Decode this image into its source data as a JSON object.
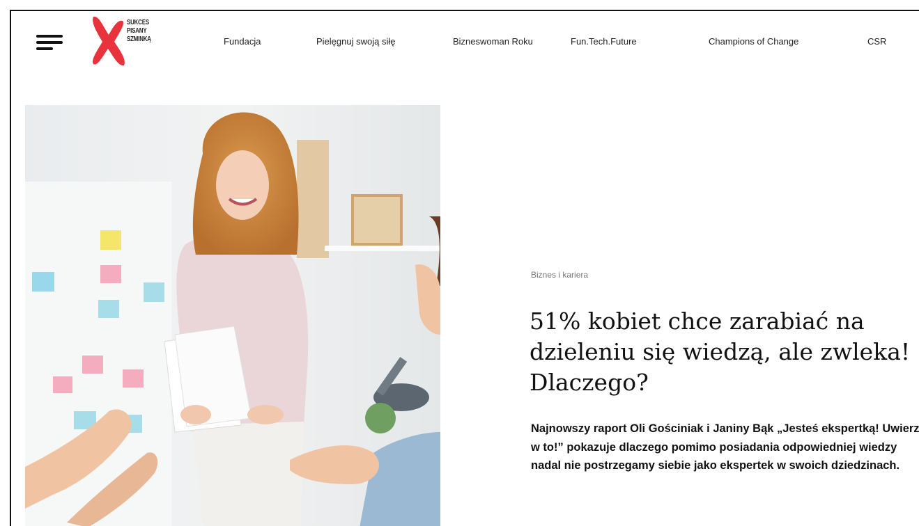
{
  "header": {
    "menu_icon": "hamburger-menu-icon",
    "logo": {
      "text_lines": [
        "SUKCES",
        "PISANY",
        "SZMINKĄ"
      ],
      "mark_color": "#e8323c"
    },
    "nav": [
      {
        "label": "Fundacja"
      },
      {
        "label": "Pielęgnuj swoją siłę"
      },
      {
        "label": "Bizneswoman Roku"
      },
      {
        "label": "Fun.Tech.Future"
      },
      {
        "label": "Champions of Change"
      },
      {
        "label": "CSR"
      }
    ]
  },
  "article": {
    "category": "Biznes i kariera",
    "title": "51% kobiet chce zarabiać na dzieleniu się wiedzą, ale zwleka! Dlaczego?",
    "lead": "Najnowszy raport Oli Gościniak i Janiny Bąk „Jesteś ekspertką! Uwierz w to!” pokazuje dlaczego pomimo posiadania odpowiedniej wiedzy nadal nie postrzegamy siebie jako ekspertek w swoich dziedzinach."
  }
}
